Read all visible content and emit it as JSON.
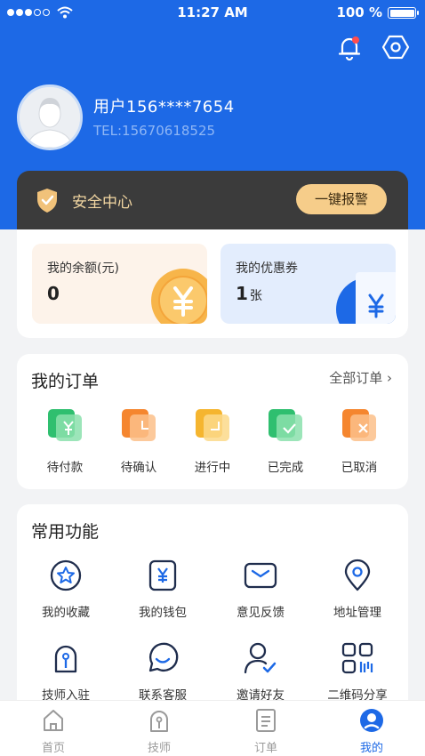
{
  "status_bar": {
    "time": "11:27 AM",
    "battery": "100 %"
  },
  "profile": {
    "username": "用户156****7654",
    "tel": "TEL:15670618525"
  },
  "safety": {
    "label": "安全中心",
    "alarm_button": "一键报警"
  },
  "wallet": {
    "balance": {
      "title": "我的余额(元)",
      "value": "0"
    },
    "coupons": {
      "title": "我的优惠券",
      "value": "1",
      "unit": "张"
    }
  },
  "orders": {
    "title": "我的订单",
    "all_link": "全部订单",
    "items": [
      {
        "label": "待付款",
        "icon": "yen-icon",
        "color": "#2fbf6f"
      },
      {
        "label": "待确认",
        "icon": "clock-icon",
        "color": "#f5862f"
      },
      {
        "label": "进行中",
        "icon": "progress-icon",
        "color": "#f5b52f"
      },
      {
        "label": "已完成",
        "icon": "check-icon",
        "color": "#2fbf6f"
      },
      {
        "label": "已取消",
        "icon": "cancel-icon",
        "color": "#f5862f"
      }
    ]
  },
  "functions": {
    "title": "常用功能",
    "items": [
      {
        "label": "我的收藏",
        "icon": "star-icon"
      },
      {
        "label": "我的钱包",
        "icon": "wallet-icon"
      },
      {
        "label": "意见反馈",
        "icon": "feedback-icon"
      },
      {
        "label": "地址管理",
        "icon": "location-icon"
      },
      {
        "label": "技师入驻",
        "icon": "technician-icon"
      },
      {
        "label": "联系客服",
        "icon": "service-icon"
      },
      {
        "label": "邀请好友",
        "icon": "invite-icon"
      },
      {
        "label": "二维码分享",
        "icon": "qrcode-icon"
      }
    ]
  },
  "tabs": [
    {
      "label": "首页",
      "icon": "home-icon"
    },
    {
      "label": "技师",
      "icon": "technician-icon"
    },
    {
      "label": "订单",
      "icon": "orders-icon"
    },
    {
      "label": "我的",
      "icon": "profile-icon",
      "active": true
    }
  ],
  "colors": {
    "primary": "#1d69e6",
    "safety_bg": "#3b3b3b",
    "alarm": "#f6cd8a"
  }
}
